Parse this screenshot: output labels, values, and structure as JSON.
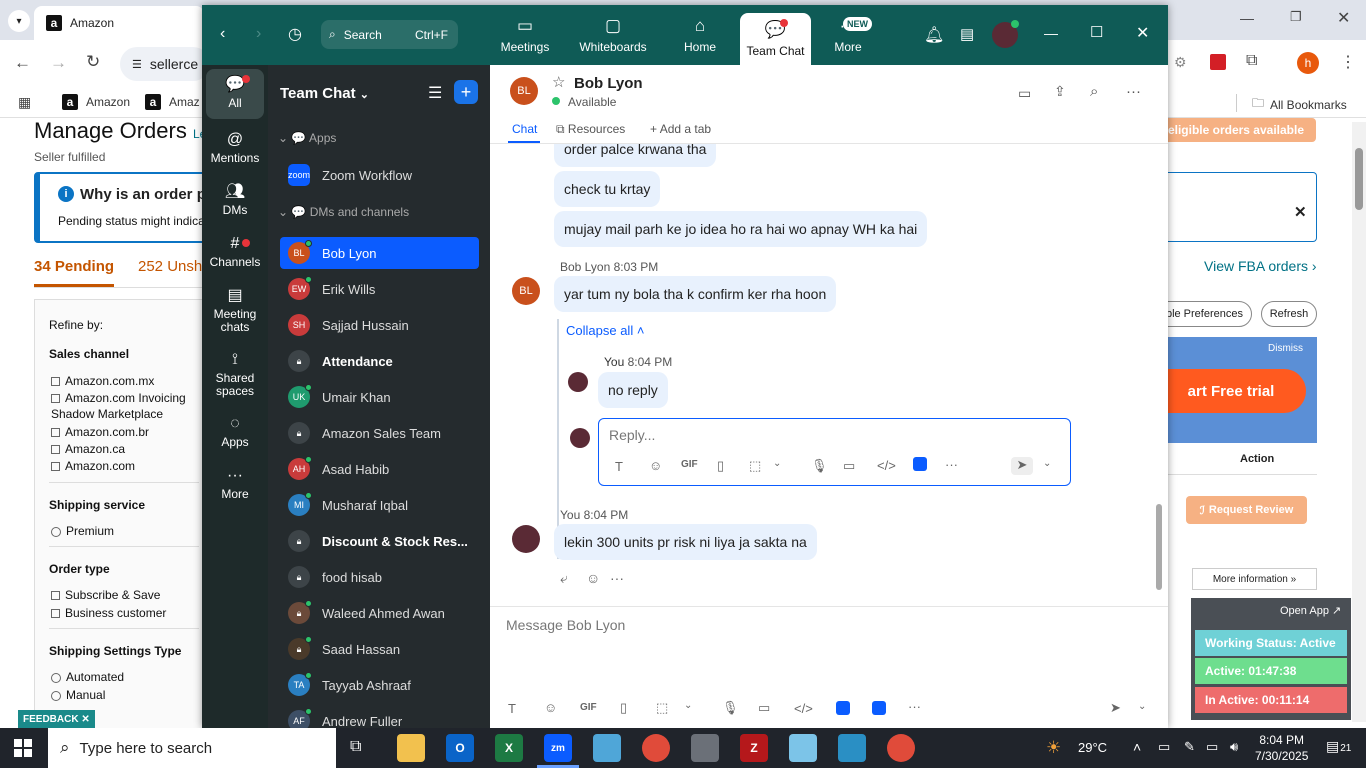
{
  "browser": {
    "tab_title": "Amazon",
    "address": "sellerce",
    "bookmarks": [
      "Amazon",
      "Amaz"
    ],
    "all_bookmarks": "All Bookmarks",
    "profile_letter": "h"
  },
  "amazon": {
    "page_title": "Manage Orders",
    "title_link": "Le",
    "subtitle": "Seller fulfilled",
    "info_title": "Why is an order pe",
    "info_text": "Pending status might indicat",
    "tab_pending": "34 Pending",
    "tab_unshipped": "252 Unshi",
    "no_orders_banner": "No eligible orders available",
    "view_fba": "View FBA orders ›",
    "table_pref": "able Preferences",
    "refresh": "Refresh",
    "dismiss": "Dismiss",
    "free_trial": "art Free trial",
    "action_header": "Action",
    "request_review": "Request Review",
    "more_info": "More information »",
    "refine": "Refine by:",
    "sales_channel": "Sales channel",
    "channels": [
      "Amazon.com.mx",
      "Amazon.com Invoicing",
      "Shadow Marketplace",
      "Amazon.com.br",
      "Amazon.ca",
      "Amazon.com"
    ],
    "shipping_service": "Shipping service",
    "premium": "Premium",
    "order_type": "Order type",
    "order_types": [
      "Subscribe & Save",
      "Business customer"
    ],
    "shipping_settings": "Shipping Settings Type",
    "settings_types": [
      "Automated",
      "Manual"
    ],
    "feedback": "FEEDBACK ✕"
  },
  "zoom": {
    "search_label": "Search",
    "search_shortcut": "Ctrl+F",
    "nav": [
      {
        "label": "Meetings",
        "icon": "video-icon"
      },
      {
        "label": "Whiteboards",
        "icon": "whiteboard-icon"
      },
      {
        "label": "Home",
        "icon": "home-icon"
      },
      {
        "label": "Team Chat",
        "icon": "chat-icon"
      },
      {
        "label": "More",
        "icon": "more-icon"
      }
    ],
    "new_badge": "NEW",
    "rail": [
      "All",
      "Mentions",
      "DMs",
      "Channels",
      "Meeting chats",
      "Shared spaces",
      "Apps",
      "More"
    ],
    "list_title": "Team Chat",
    "section_apps": "Apps",
    "zoom_workflow": "Zoom Workflow",
    "section_dms": "DMs and channels",
    "contacts": [
      {
        "name": "Bob Lyon",
        "initials": "BL",
        "color": "#c9501c"
      },
      {
        "name": "Erik Wills",
        "initials": "EW",
        "color": "#c93b3b"
      },
      {
        "name": "Sajjad Hussain",
        "initials": "SH",
        "color": "#c93b3b"
      },
      {
        "name": "Attendance",
        "initials": "",
        "color": "#3d4448"
      },
      {
        "name": "Umair Khan",
        "initials": "UK",
        "color": "#1f9b6e"
      },
      {
        "name": "Amazon Sales Team",
        "initials": "",
        "color": "#3d4448"
      },
      {
        "name": "Asad Habib",
        "initials": "AH",
        "color": "#c93b3b"
      },
      {
        "name": "Musharaf Iqbal",
        "initials": "MI",
        "color": "#2a7fc1"
      },
      {
        "name": "Discount & Stock Res...",
        "initials": "",
        "color": "#3d4448"
      },
      {
        "name": "food hisab",
        "initials": "",
        "color": "#3d4448"
      },
      {
        "name": "Waleed Ahmed Awan",
        "initials": "",
        "color": "#6b4a3a"
      },
      {
        "name": "Saad Hassan",
        "initials": "",
        "color": "#4a3a2a"
      },
      {
        "name": "Tayyab Ashraaf",
        "initials": "TA",
        "color": "#2a7fc1"
      },
      {
        "name": "Andrew Fuller",
        "initials": "AF",
        "color": "#3d4f66"
      }
    ],
    "chat": {
      "contact_initials": "BL",
      "contact_name": "Bob Lyon",
      "status": "Available",
      "tabs": [
        "Chat",
        "Resources",
        "Add a tab"
      ],
      "msgs_top": [
        "order palce krwana tha",
        "check tu krtay",
        "mujay mail parh ke jo idea ho ra hai wo apnay WH ka hai"
      ],
      "bob_meta": "Bob Lyon 8:03 PM",
      "bob_msg": "yar tum ny bola tha k confirm ker rha hoon",
      "collapse": "Collapse all ˄",
      "reply_meta_you": "You",
      "reply_meta_time": "8:04 PM",
      "reply_msg": "no reply",
      "reply_placeholder": "Reply...",
      "you_meta": "You 8:04 PM",
      "you_msg": "lekin 300 units pr risk ni liya ja sakta na",
      "composer_placeholder": "Message Bob Lyon"
    }
  },
  "tracker": {
    "open_app": "Open App ↗",
    "working_status": "Working Status: Active",
    "active": "Active: 01:47:38",
    "inactive": "In Active: 00:11:14"
  },
  "taskbar": {
    "search_placeholder": "Type here to search",
    "temperature": "29°C",
    "time": "8:04 PM",
    "date": "7/30/2025",
    "notifications": "21"
  }
}
